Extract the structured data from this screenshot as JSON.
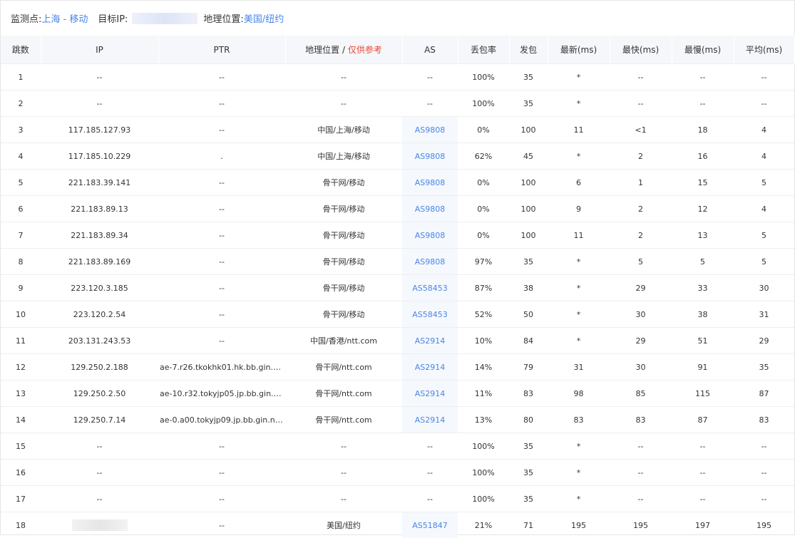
{
  "header": {
    "monitor_label": "监测点:",
    "monitor_value": "上海 - 移动",
    "target_label": "目标IP:",
    "geo_label": "地理位置:",
    "geo_value": "美国/纽约"
  },
  "table": {
    "columns": {
      "hop": "跳数",
      "ip": "IP",
      "ptr": "PTR",
      "geo": "地理位置 / ",
      "geo_note": "仅供参考",
      "as": "AS",
      "loss": "丢包率",
      "sent": "发包",
      "latest": "最新(ms)",
      "fastest": "最快(ms)",
      "slowest": "最慢(ms)",
      "avg": "平均(ms)"
    },
    "rows": [
      {
        "hop": "1",
        "ip": "--",
        "ptr": "--",
        "geo": "--",
        "as": "--",
        "loss": "100%",
        "sent": "35",
        "latest": "*",
        "fastest": "--",
        "slowest": "--",
        "avg": "--"
      },
      {
        "hop": "2",
        "ip": "--",
        "ptr": "--",
        "geo": "--",
        "as": "--",
        "loss": "100%",
        "sent": "35",
        "latest": "*",
        "fastest": "--",
        "slowest": "--",
        "avg": "--"
      },
      {
        "hop": "3",
        "ip": "117.185.127.93",
        "ptr": "--",
        "geo": "中国/上海/移动",
        "as": "AS9808",
        "loss": "0%",
        "sent": "100",
        "latest": "11",
        "fastest": "<1",
        "slowest": "18",
        "avg": "4"
      },
      {
        "hop": "4",
        "ip": "117.185.10.229",
        "ptr": ".",
        "geo": "中国/上海/移动",
        "as": "AS9808",
        "loss": "62%",
        "sent": "45",
        "latest": "*",
        "fastest": "2",
        "slowest": "16",
        "avg": "4"
      },
      {
        "hop": "5",
        "ip": "221.183.39.141",
        "ptr": "--",
        "geo": "骨干网/移动",
        "as": "AS9808",
        "loss": "0%",
        "sent": "100",
        "latest": "6",
        "fastest": "1",
        "slowest": "15",
        "avg": "5"
      },
      {
        "hop": "6",
        "ip": "221.183.89.13",
        "ptr": "--",
        "geo": "骨干网/移动",
        "as": "AS9808",
        "loss": "0%",
        "sent": "100",
        "latest": "9",
        "fastest": "2",
        "slowest": "12",
        "avg": "4"
      },
      {
        "hop": "7",
        "ip": "221.183.89.34",
        "ptr": "--",
        "geo": "骨干网/移动",
        "as": "AS9808",
        "loss": "0%",
        "sent": "100",
        "latest": "11",
        "fastest": "2",
        "slowest": "13",
        "avg": "5"
      },
      {
        "hop": "8",
        "ip": "221.183.89.169",
        "ptr": "--",
        "geo": "骨干网/移动",
        "as": "AS9808",
        "loss": "97%",
        "sent": "35",
        "latest": "*",
        "fastest": "5",
        "slowest": "5",
        "avg": "5"
      },
      {
        "hop": "9",
        "ip": "223.120.3.185",
        "ptr": "--",
        "geo": "骨干网/移动",
        "as": "AS58453",
        "loss": "87%",
        "sent": "38",
        "latest": "*",
        "fastest": "29",
        "slowest": "33",
        "avg": "30"
      },
      {
        "hop": "10",
        "ip": "223.120.2.54",
        "ptr": "--",
        "geo": "骨干网/移动",
        "as": "AS58453",
        "loss": "52%",
        "sent": "50",
        "latest": "*",
        "fastest": "30",
        "slowest": "38",
        "avg": "31"
      },
      {
        "hop": "11",
        "ip": "203.131.243.53",
        "ptr": "--",
        "geo": "中国/香港/ntt.com",
        "as": "AS2914",
        "loss": "10%",
        "sent": "84",
        "latest": "*",
        "fastest": "29",
        "slowest": "51",
        "avg": "29"
      },
      {
        "hop": "12",
        "ip": "129.250.2.188",
        "ptr": "ae-7.r26.tkokhk01.hk.bb.gin.n...",
        "geo": "骨干网/ntt.com",
        "as": "AS2914",
        "loss": "14%",
        "sent": "79",
        "latest": "31",
        "fastest": "30",
        "slowest": "91",
        "avg": "35"
      },
      {
        "hop": "13",
        "ip": "129.250.2.50",
        "ptr": "ae-10.r32.tokyjp05.jp.bb.gin.n...",
        "geo": "骨干网/ntt.com",
        "as": "AS2914",
        "loss": "11%",
        "sent": "83",
        "latest": "98",
        "fastest": "85",
        "slowest": "115",
        "avg": "87"
      },
      {
        "hop": "14",
        "ip": "129.250.7.14",
        "ptr": "ae-0.a00.tokyjp09.jp.bb.gin.nt...",
        "geo": "骨干网/ntt.com",
        "as": "AS2914",
        "loss": "13%",
        "sent": "80",
        "latest": "83",
        "fastest": "83",
        "slowest": "87",
        "avg": "83"
      },
      {
        "hop": "15",
        "ip": "--",
        "ptr": "--",
        "geo": "--",
        "as": "--",
        "loss": "100%",
        "sent": "35",
        "latest": "*",
        "fastest": "--",
        "slowest": "--",
        "avg": "--"
      },
      {
        "hop": "16",
        "ip": "--",
        "ptr": "--",
        "geo": "--",
        "as": "--",
        "loss": "100%",
        "sent": "35",
        "latest": "*",
        "fastest": "--",
        "slowest": "--",
        "avg": "--"
      },
      {
        "hop": "17",
        "ip": "--",
        "ptr": "--",
        "geo": "--",
        "as": "--",
        "loss": "100%",
        "sent": "35",
        "latest": "*",
        "fastest": "--",
        "slowest": "--",
        "avg": "--"
      },
      {
        "hop": "18",
        "ip": "",
        "ptr": "--",
        "geo": "美国/纽约",
        "as": "AS51847",
        "loss": "21%",
        "sent": "71",
        "latest": "195",
        "fastest": "195",
        "slowest": "197",
        "avg": "195"
      }
    ]
  },
  "colors": {
    "link_blue": "#4a86e8",
    "note_red": "#e8473b",
    "header_bg": "#f5f7fa",
    "as_bg": "#f5f8fd"
  }
}
